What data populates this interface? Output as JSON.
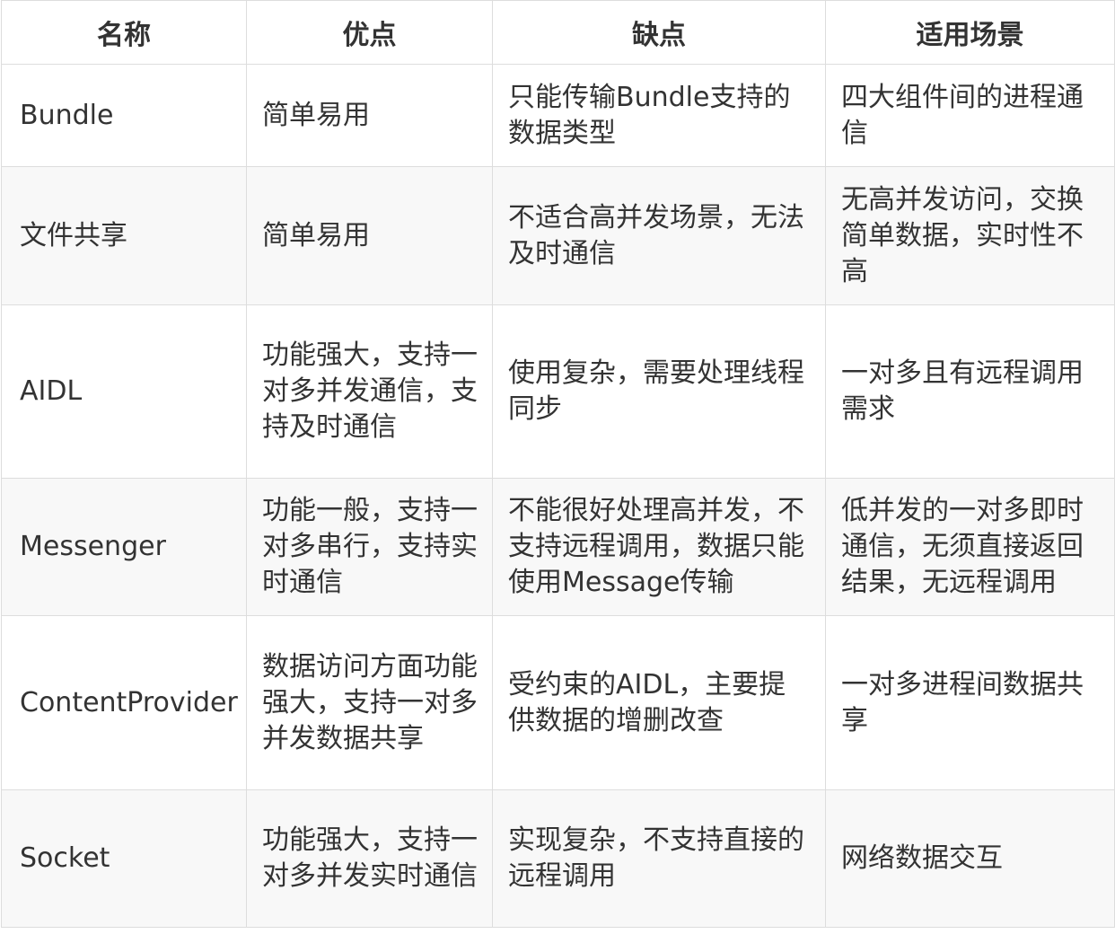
{
  "table": {
    "headers": [
      "名称",
      "优点",
      "缺点",
      "适用场景"
    ],
    "rows": [
      [
        "Bundle",
        "简单易用",
        "只能传输Bundle支持的数据类型",
        "四大组件间的进程通信"
      ],
      [
        "文件共享",
        "简单易用",
        "不适合高并发场景，无法及时通信",
        "无高并发访问，交换简单数据，实时性不高"
      ],
      [
        "AIDL",
        "功能强大，支持一对多并发通信，支持及时通信",
        "使用复杂，需要处理线程同步",
        "一对多且有远程调用需求"
      ],
      [
        "Messenger",
        "功能一般，支持一对多串行，支持实时通信",
        "不能很好处理高并发，不支持远程调用，数据只能使用Message传输",
        "低并发的一对多即时通信，无须直接返回结果，无远程调用"
      ],
      [
        "ContentProvider",
        "数据访问方面功能强大，支持一对多并发数据共享",
        "受约束的AIDL，主要提供数据的增删改查",
        "一对多进程间数据共享"
      ],
      [
        "Socket",
        "功能强大，支持一对多并发实时通信",
        "实现复杂，不支持直接的远程调用",
        "网络数据交互"
      ]
    ]
  }
}
